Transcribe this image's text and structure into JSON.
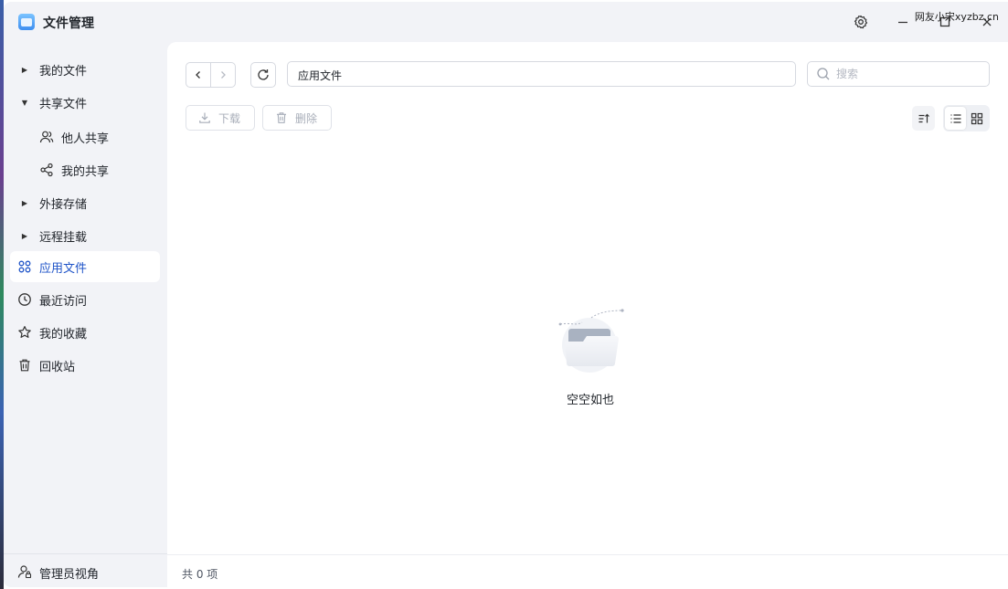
{
  "window": {
    "title": "文件管理",
    "watermark": "网友小宋xyzbz.cn"
  },
  "sidebar": {
    "items": [
      {
        "label": "我的文件",
        "icon": "caret-right-icon"
      },
      {
        "label": "共享文件",
        "icon": "caret-down-icon"
      },
      {
        "label": "他人共享",
        "icon": "users-icon"
      },
      {
        "label": "我的共享",
        "icon": "share-icon"
      },
      {
        "label": "外接存储",
        "icon": "caret-right-icon"
      },
      {
        "label": "远程挂载",
        "icon": "caret-right-icon"
      },
      {
        "label": "应用文件",
        "icon": "apps-icon",
        "active": true
      },
      {
        "label": "最近访问",
        "icon": "clock-icon"
      },
      {
        "label": "我的收藏",
        "icon": "star-icon"
      },
      {
        "label": "回收站",
        "icon": "trash-icon"
      }
    ],
    "footer": {
      "label": "管理员视角",
      "icon": "admin-user-icon"
    }
  },
  "toolbar": {
    "path": "应用文件",
    "search_placeholder": "搜索",
    "download_label": "下载",
    "delete_label": "删除"
  },
  "empty_state": {
    "text": "空空如也"
  },
  "status": {
    "count_text": "共 0 项"
  },
  "colors": {
    "accent": "#1f54c8",
    "window_bg": "#f2f3f7",
    "panel_bg": "#ffffff"
  }
}
